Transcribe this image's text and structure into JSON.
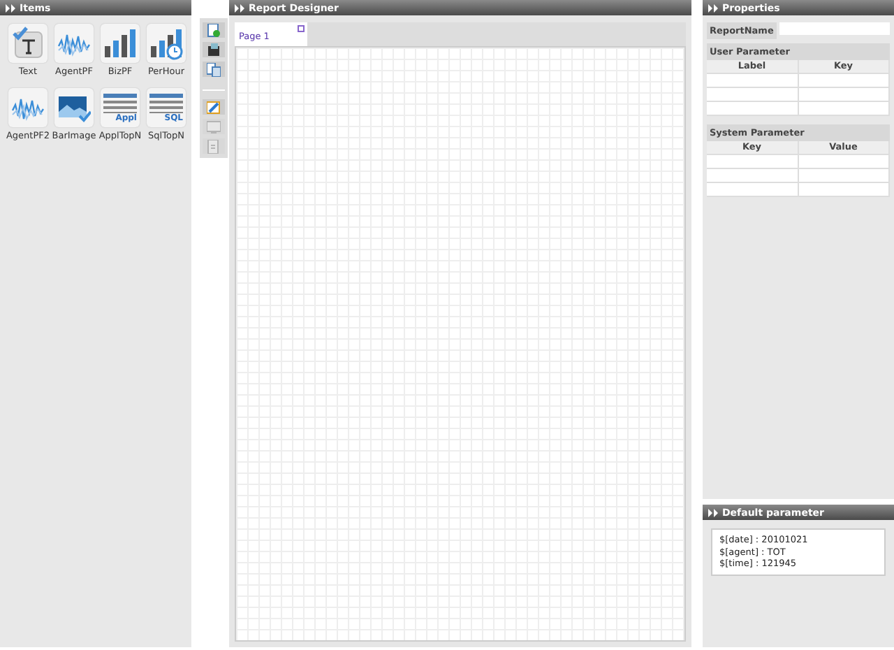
{
  "items_panel": {
    "title": "Items",
    "items": [
      {
        "label": "Text",
        "kind": "text"
      },
      {
        "label": "AgentPF",
        "kind": "wave"
      },
      {
        "label": "BizPF",
        "kind": "bars"
      },
      {
        "label": "PerHour",
        "kind": "bars_clock"
      },
      {
        "label": "AgentPF2",
        "kind": "wave"
      },
      {
        "label": "BarImage",
        "kind": "image"
      },
      {
        "label": "ApplTopN",
        "kind": "table",
        "badge": "Appl"
      },
      {
        "label": "SqlTopN",
        "kind": "table",
        "badge": "SQL"
      }
    ]
  },
  "toolbar": {
    "groups": [
      [
        {
          "kind": "add",
          "disabled": false
        },
        {
          "kind": "save",
          "disabled": false
        },
        {
          "kind": "copy",
          "disabled": false
        }
      ],
      [
        {
          "kind": "edit",
          "disabled": false
        },
        {
          "kind": "preview",
          "disabled": true
        },
        {
          "kind": "export",
          "disabled": true
        }
      ]
    ]
  },
  "designer": {
    "title": "Report Designer",
    "pages": [
      {
        "label": "Page 1",
        "selected": true
      }
    ]
  },
  "properties": {
    "title": "Properties",
    "report_name": {
      "label": "ReportName"
    },
    "sections": [
      {
        "title": "User Parameter",
        "columns": [
          "Label",
          "Key"
        ]
      },
      {
        "title": "System Parameter",
        "columns": [
          "Key",
          "Value"
        ]
      }
    ]
  },
  "default_parameter": {
    "title": "Default parameter",
    "lines": [
      "$[date] : 20101021",
      "$[agent] : TOT",
      "$[time] : 121945"
    ]
  }
}
